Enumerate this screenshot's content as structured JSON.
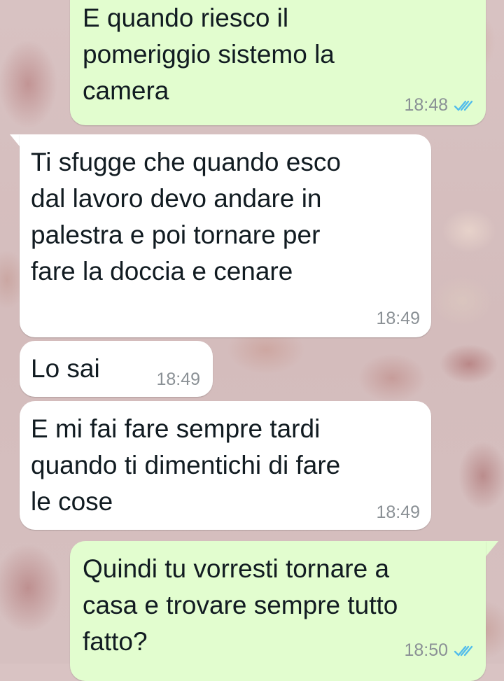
{
  "chat": {
    "messages": [
      {
        "direction": "outgoing",
        "text": "E quando riesco il\npomeriggio sistemo la\ncamera",
        "time": "18:48",
        "status_icon": "double-check-read-icon",
        "status_color": "#53bdeb"
      },
      {
        "direction": "incoming",
        "text": "Ti sfugge che quando esco\ndal lavoro devo andare in\npalestra e poi tornare per\nfare la doccia e cenare",
        "time": "18:49"
      },
      {
        "direction": "incoming",
        "text": "Lo sai",
        "time": "18:49"
      },
      {
        "direction": "incoming",
        "text": "E mi fai fare sempre tardi\nquando ti dimentichi di fare\nle cose",
        "time": "18:49"
      },
      {
        "direction": "outgoing",
        "text": "Quindi tu vorresti tornare a\ncasa e trovare sempre tutto\nfatto?",
        "time": "18:50",
        "status_icon": "double-check-read-icon",
        "status_color": "#53bdeb"
      }
    ]
  },
  "colors": {
    "outgoing_bubble": "#e2fdcf",
    "incoming_bubble": "#ffffff",
    "timestamp": "#8a9095",
    "read_ticks": "#53bdeb"
  }
}
